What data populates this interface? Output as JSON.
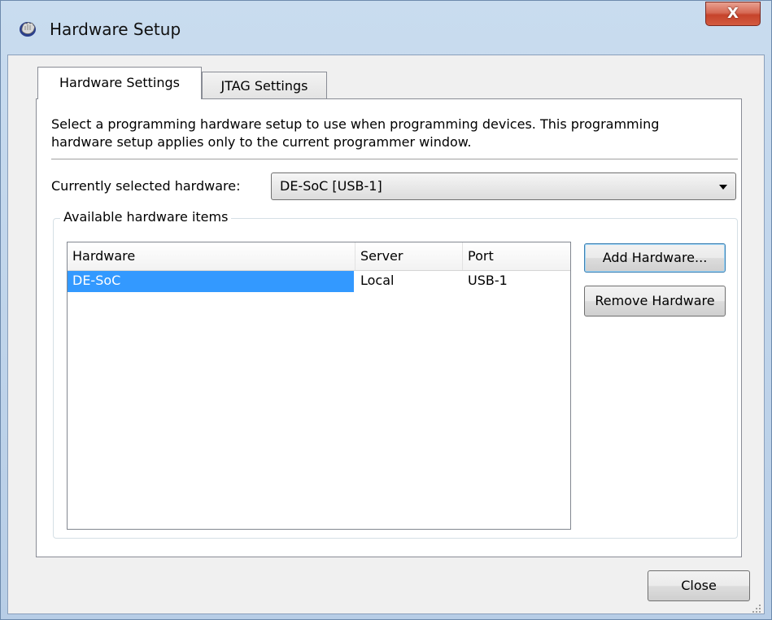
{
  "window": {
    "title": "Hardware Setup",
    "close_glyph": "X"
  },
  "tabs": [
    {
      "label": "Hardware Settings",
      "active": true
    },
    {
      "label": "JTAG Settings",
      "active": false
    }
  ],
  "panel": {
    "description": "Select a programming hardware setup to use when programming devices. This programming hardware setup applies only to the current programmer window.",
    "selected_label": "Currently selected hardware:",
    "selected_value": "DE-SoC [USB-1]",
    "group_title": "Available hardware items",
    "columns": [
      "Hardware",
      "Server",
      "Port"
    ],
    "rows": [
      {
        "hardware": "DE-SoC",
        "server": "Local",
        "port": "USB-1",
        "selected": true
      }
    ],
    "add_button": "Add Hardware...",
    "remove_button": "Remove Hardware"
  },
  "footer": {
    "close_button": "Close"
  },
  "icons": {
    "app": "hardware-hand-icon",
    "dropdown": "chevron-down-icon"
  },
  "colors": {
    "selection": "#3399ff",
    "close_button": "#c6432b"
  }
}
